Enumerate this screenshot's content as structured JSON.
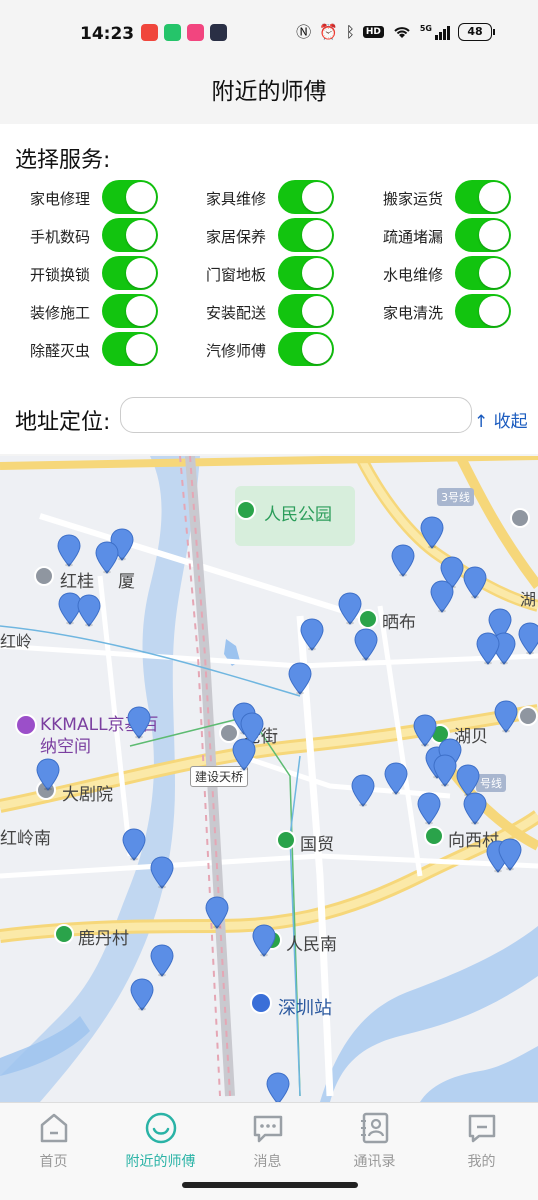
{
  "status_bar": {
    "time": "14:23",
    "battery": "48",
    "hd": "HD",
    "signal_label": "5G",
    "app_icon_colors": [
      "#f0463c",
      "#25c46a",
      "#f2457f",
      "#2a2f45"
    ],
    "icons": [
      "nfc-icon",
      "alarm-icon",
      "bluetooth-icon",
      "hd-icon",
      "wifi-icon",
      "signal-icon",
      "battery-icon"
    ]
  },
  "header": {
    "title": "附近的师傅"
  },
  "services": {
    "title": "选择服务:",
    "items": [
      {
        "label": "家电修理",
        "on": true
      },
      {
        "label": "家具维修",
        "on": true
      },
      {
        "label": "搬家运货",
        "on": true
      },
      {
        "label": "手机数码",
        "on": true
      },
      {
        "label": "家居保养",
        "on": true
      },
      {
        "label": "疏通堵漏",
        "on": true
      },
      {
        "label": "开锁换锁",
        "on": true
      },
      {
        "label": "门窗地板",
        "on": true
      },
      {
        "label": "水电维修",
        "on": true
      },
      {
        "label": "装修施工",
        "on": true
      },
      {
        "label": "安装配送",
        "on": true
      },
      {
        "label": "家电清洗",
        "on": true
      },
      {
        "label": "除醛灭虫",
        "on": true
      },
      {
        "label": "汽修师傅",
        "on": true
      }
    ],
    "toggle_color": "#12c40f"
  },
  "address": {
    "label": "地址定位:",
    "value": "",
    "collapse_label": "↑ 收起"
  },
  "map": {
    "labels": {
      "park": "人民公园",
      "honggui": "红桂",
      "honggui_suffix": "厦",
      "hongling": "红岭",
      "shaibu": "晒布",
      "kkmall_1": "KKMALL京基百",
      "kkmall_2": "纳空间",
      "laojie": "老街",
      "jianshe": "建设天桥",
      "hubei": "湖贝",
      "juyuan": "大剧院",
      "honglingnan": "红岭南",
      "guomao": "国贸",
      "xiangxicun": "向西村",
      "ludancun": "鹿丹村",
      "renminnan": "人民南",
      "shenzhen_station": "深圳站",
      "line3": "3号线",
      "hu": "湖",
      "line_badge2": "号线"
    }
  },
  "nav": {
    "items": [
      {
        "label": "首页",
        "icon": "home-icon",
        "active": false
      },
      {
        "label": "附近的师傅",
        "icon": "smile-icon",
        "active": true
      },
      {
        "label": "消息",
        "icon": "message-icon",
        "active": false
      },
      {
        "label": "通讯录",
        "icon": "contacts-icon",
        "active": false
      },
      {
        "label": "我的",
        "icon": "profile-icon",
        "active": false
      }
    ],
    "active_color": "#2ab3a6"
  }
}
